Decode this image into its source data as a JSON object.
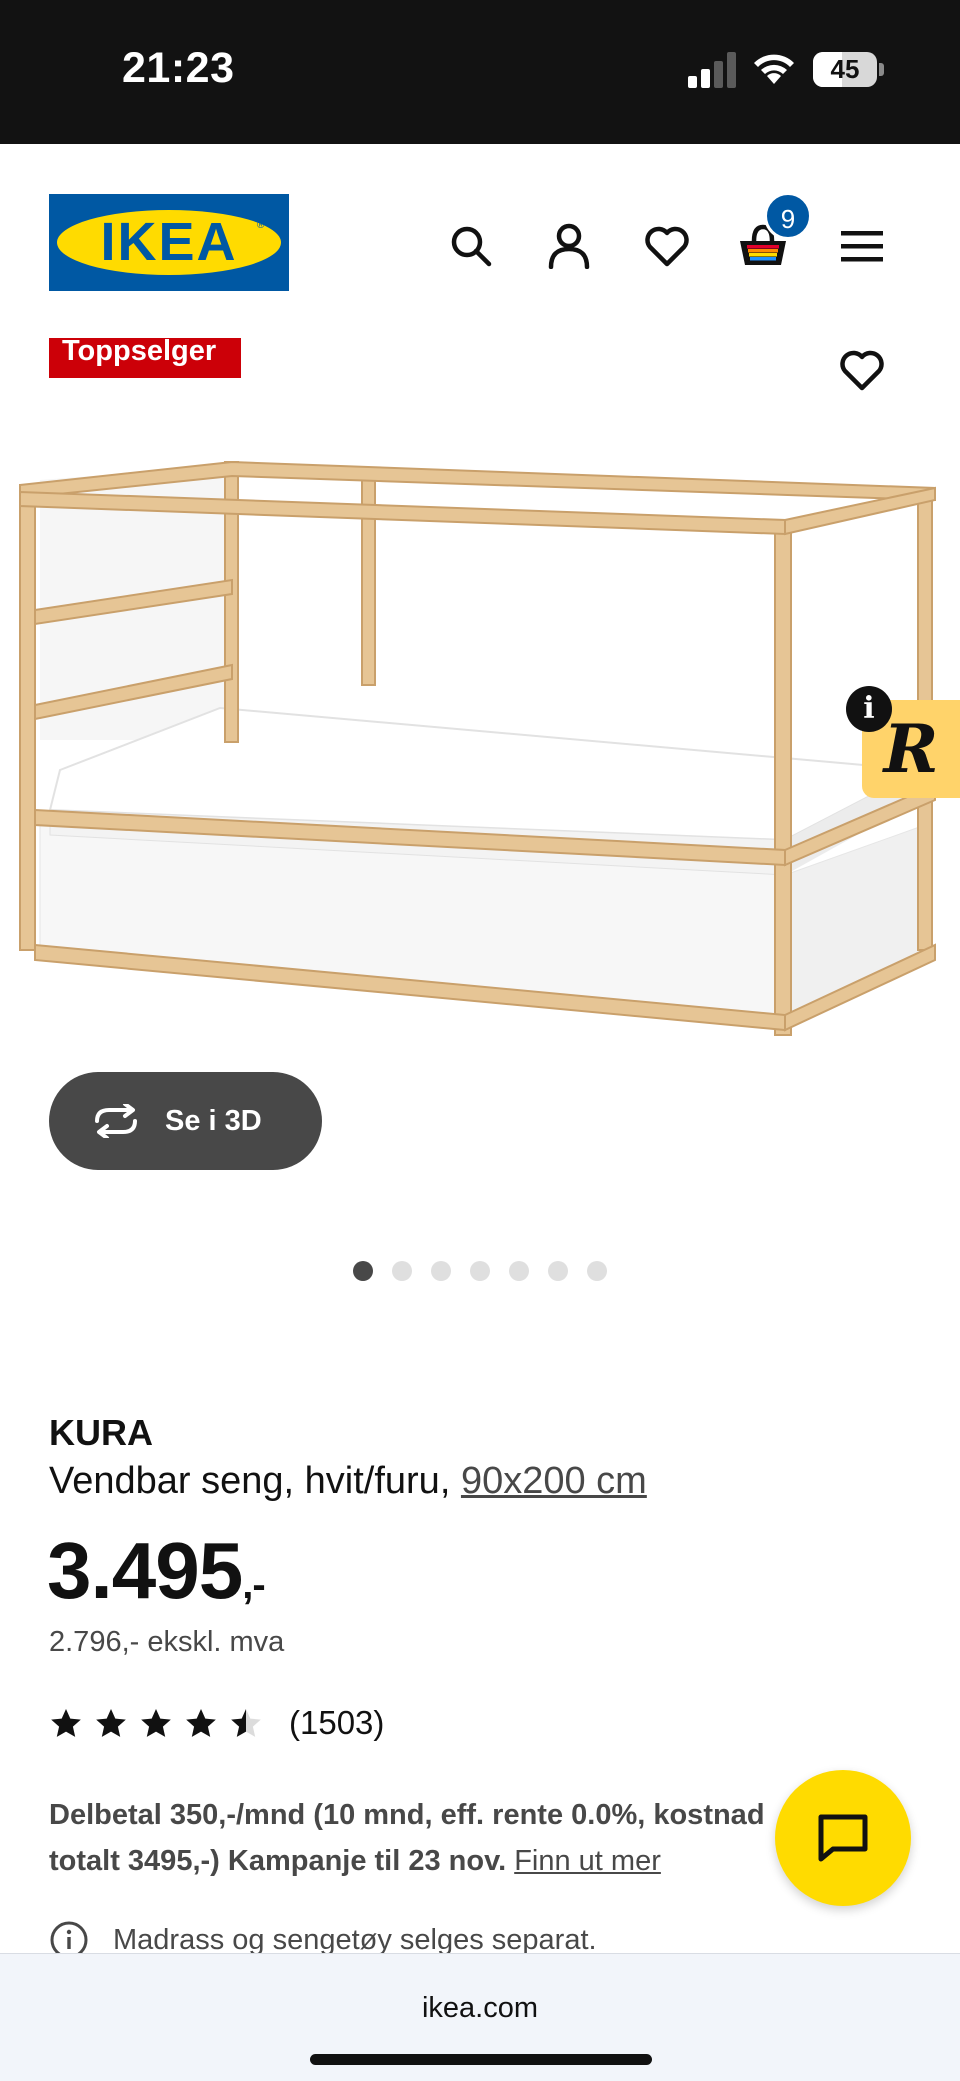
{
  "status_bar": {
    "time": "21:23",
    "battery": "45",
    "battery_level": 0.45
  },
  "header": {
    "logo_text": "IKEA",
    "cart_count": "9",
    "icons": [
      "search-icon",
      "account-icon",
      "heart-icon",
      "cart-icon",
      "menu-icon"
    ]
  },
  "product": {
    "badge": "Toppselger",
    "view_3d_label": "Se i 3D",
    "gallery_count": 7,
    "gallery_active": 0,
    "name": "KURA",
    "description": "Vendbar seng, hvit/furu,",
    "size": "90x200 cm",
    "price": "3.495",
    "price_suffix": ",-",
    "price_ex_vat": "2.796,- ekskl. mva",
    "rating": 4.5,
    "rating_max": 5,
    "review_count": "(1503)",
    "installment_text": "Delbetal 350,-/mnd (10 mnd, eff. rente 0.0%, kostnad totalt 3495,-) Kampanje til 23 nov.",
    "installment_link": "Finn ut mer",
    "note": "Madrass og sengetøy selges separat."
  },
  "widget": {
    "info_symbol": "i",
    "logo_letter": "R"
  },
  "browser": {
    "url": "ikea.com"
  },
  "colors": {
    "brand_blue": "#0058a3",
    "brand_yellow": "#ffdb00",
    "badge_red": "#cc0008",
    "button_dark": "#484848"
  }
}
